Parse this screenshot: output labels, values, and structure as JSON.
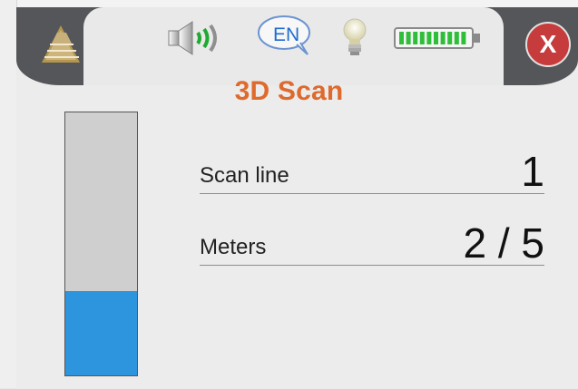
{
  "topbar": {
    "logo_icon": "pyramid-logo-icon",
    "speaker_icon": "speaker-volume-icon",
    "language_label": "EN",
    "bulb_icon": "lightbulb-icon",
    "battery_icon": "battery-icon",
    "close_label": "X",
    "battery_level": 1.0
  },
  "page": {
    "title": "3D Scan"
  },
  "fields": {
    "scan_line_label": "Scan line",
    "scan_line_value": "1",
    "meters_label": "Meters",
    "meters_value": "2 / 5"
  },
  "progress": {
    "fill_fraction": 0.32
  },
  "colors": {
    "accent_orange": "#de6a2d",
    "progress_blue": "#2d95de",
    "close_red": "#c63b3b",
    "battery_green": "#2fbe3a",
    "topbar_dark": "#555659"
  }
}
